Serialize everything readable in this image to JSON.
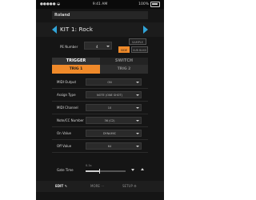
{
  "status_bar": {
    "carrier": "●●●●● ◒",
    "time": "9:41 AM",
    "battery": "100%"
  },
  "brand": {
    "logo": "Roland"
  },
  "kit": {
    "title": "KIT 1: Rock"
  },
  "pe": {
    "label": "PE Number",
    "value": "4"
  },
  "modes": {
    "sample": "SAMPLE",
    "side": "SIDE",
    "sub_bass": "SUB BASS",
    "side_active": true
  },
  "tabs": {
    "trigger": "TRIGGER",
    "switch": "SWITCH",
    "trig1": "TRIG 1",
    "trig2": "TRIG 2"
  },
  "settings": [
    {
      "label": "MIDI Output",
      "value": "ON"
    },
    {
      "label": "Assign Type",
      "value": "NOTE (ONE SHOT)"
    },
    {
      "label": "MIDI Channel",
      "value": "10"
    },
    {
      "label": "Note/CC Number",
      "value": "36 (C2)"
    },
    {
      "label": "On Value",
      "value": "DYNAMIC"
    },
    {
      "label": "Off Value",
      "value": "64"
    }
  ],
  "gate": {
    "label": "Gate Time",
    "value": "0.1s",
    "level": 0.35
  },
  "bottom_nav": {
    "edit": "EDIT",
    "more": "MORE",
    "setup": "SETUP"
  },
  "colors": {
    "accent": "#f08a2a",
    "nav_blue": "#31a4d8",
    "background": "#151515"
  }
}
